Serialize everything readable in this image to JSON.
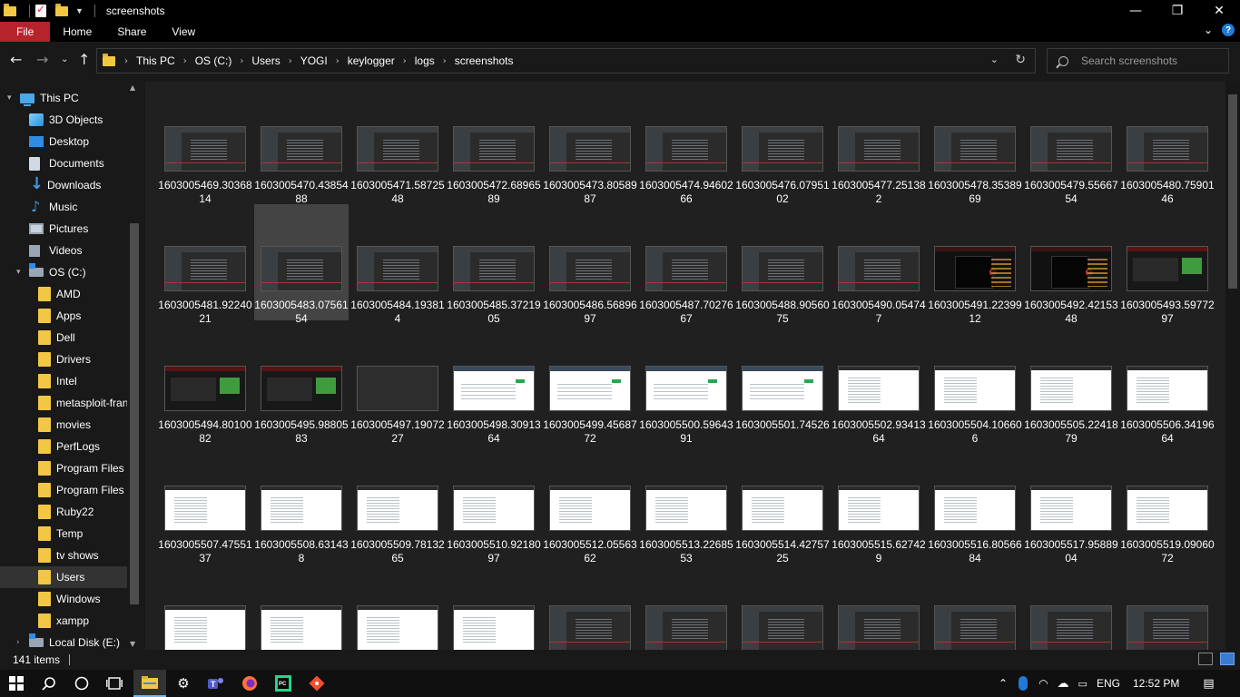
{
  "window": {
    "title": "screenshots",
    "controls": {
      "minimize": "—",
      "maximize": "❐",
      "close": "✕"
    }
  },
  "ribbon": {
    "tabs": [
      "File",
      "Home",
      "Share",
      "View"
    ],
    "file_color": "#b7232c"
  },
  "address": {
    "crumbs": [
      "This PC",
      "OS (C:)",
      "Users",
      "YOGI",
      "keylogger",
      "logs",
      "screenshots"
    ]
  },
  "search": {
    "placeholder": "Search screenshots"
  },
  "sidebar": {
    "items": [
      {
        "label": "This PC",
        "icon": "pc-icon"
      },
      {
        "label": "3D Objects",
        "icon": "3d-objects-icon"
      },
      {
        "label": "Desktop",
        "icon": "desktop-icon"
      },
      {
        "label": "Documents",
        "icon": "documents-icon"
      },
      {
        "label": "Downloads",
        "icon": "downloads-icon"
      },
      {
        "label": "Music",
        "icon": "music-icon"
      },
      {
        "label": "Pictures",
        "icon": "pictures-icon"
      },
      {
        "label": "Videos",
        "icon": "videos-icon"
      },
      {
        "label": "OS (C:)",
        "icon": "drive-icon"
      },
      {
        "label": "AMD",
        "icon": "folder-icon"
      },
      {
        "label": "Apps",
        "icon": "folder-icon"
      },
      {
        "label": "Dell",
        "icon": "folder-icon"
      },
      {
        "label": "Drivers",
        "icon": "folder-icon"
      },
      {
        "label": "Intel",
        "icon": "folder-icon"
      },
      {
        "label": "metasploit-fran",
        "icon": "folder-icon"
      },
      {
        "label": "movies",
        "icon": "folder-icon"
      },
      {
        "label": "PerfLogs",
        "icon": "folder-icon"
      },
      {
        "label": "Program Files",
        "icon": "folder-icon"
      },
      {
        "label": "Program Files (",
        "icon": "folder-icon"
      },
      {
        "label": "Ruby22",
        "icon": "folder-icon"
      },
      {
        "label": "Temp",
        "icon": "folder-icon"
      },
      {
        "label": "tv shows",
        "icon": "folder-icon"
      },
      {
        "label": "Users",
        "icon": "folder-icon",
        "selected": true
      },
      {
        "label": "Windows",
        "icon": "folder-icon"
      },
      {
        "label": "xampp",
        "icon": "folder-icon"
      },
      {
        "label": "Local Disk (E:)",
        "icon": "drive-icon"
      }
    ]
  },
  "files": [
    {
      "name": "1603005469.3036814",
      "thumb": "ide"
    },
    {
      "name": "1603005470.4385488",
      "thumb": "ide"
    },
    {
      "name": "1603005471.5872548",
      "thumb": "ide"
    },
    {
      "name": "1603005472.6896589",
      "thumb": "ide"
    },
    {
      "name": "1603005473.8058987",
      "thumb": "ide"
    },
    {
      "name": "1603005474.9460266",
      "thumb": "ide"
    },
    {
      "name": "1603005476.0795102",
      "thumb": "ide"
    },
    {
      "name": "1603005477.251382",
      "thumb": "ide"
    },
    {
      "name": "1603005478.3538969",
      "thumb": "ide"
    },
    {
      "name": "1603005479.5566754",
      "thumb": "ide"
    },
    {
      "name": "1603005480.7590146",
      "thumb": "ide"
    },
    {
      "name": "1603005481.9224021",
      "thumb": "ide"
    },
    {
      "name": "1603005483.0756154",
      "thumb": "ide",
      "selected": true
    },
    {
      "name": "1603005484.193814",
      "thumb": "ide"
    },
    {
      "name": "1603005485.3721905",
      "thumb": "ide"
    },
    {
      "name": "1603005486.5689697",
      "thumb": "ide"
    },
    {
      "name": "1603005487.7027667",
      "thumb": "ide"
    },
    {
      "name": "1603005488.9056075",
      "thumb": "ide"
    },
    {
      "name": "1603005490.054747",
      "thumb": "ide"
    },
    {
      "name": "1603005491.2239912",
      "thumb": "vid"
    },
    {
      "name": "1603005492.4215348",
      "thumb": "vid"
    },
    {
      "name": "1603005493.5977297",
      "thumb": "yt"
    },
    {
      "name": "1603005494.8010082",
      "thumb": "yt"
    },
    {
      "name": "1603005495.9880583",
      "thumb": "yt"
    },
    {
      "name": "1603005497.1907227",
      "thumb": "plain"
    },
    {
      "name": "1603005498.3091364",
      "thumb": "web"
    },
    {
      "name": "1603005499.4568772",
      "thumb": "web"
    },
    {
      "name": "1603005500.5964391",
      "thumb": "web"
    },
    {
      "name": "1603005501.74526",
      "thumb": "web"
    },
    {
      "name": "1603005502.9341364",
      "thumb": "code"
    },
    {
      "name": "1603005504.106606",
      "thumb": "code"
    },
    {
      "name": "1603005505.2241879",
      "thumb": "code"
    },
    {
      "name": "1603005506.3419664",
      "thumb": "code"
    },
    {
      "name": "1603005507.4755137",
      "thumb": "code"
    },
    {
      "name": "1603005508.631438",
      "thumb": "code"
    },
    {
      "name": "1603005509.7813265",
      "thumb": "code"
    },
    {
      "name": "1603005510.9218097",
      "thumb": "code"
    },
    {
      "name": "1603005512.0556362",
      "thumb": "code"
    },
    {
      "name": "1603005513.2268553",
      "thumb": "code"
    },
    {
      "name": "1603005514.4275725",
      "thumb": "code"
    },
    {
      "name": "1603005515.627429",
      "thumb": "code"
    },
    {
      "name": "1603005516.8056684",
      "thumb": "code"
    },
    {
      "name": "1603005517.9588904",
      "thumb": "code"
    },
    {
      "name": "1603005519.0906072",
      "thumb": "code"
    },
    {
      "name": "",
      "thumb": "code"
    },
    {
      "name": "",
      "thumb": "code"
    },
    {
      "name": "",
      "thumb": "code"
    },
    {
      "name": "",
      "thumb": "code"
    },
    {
      "name": "",
      "thumb": "ide"
    },
    {
      "name": "",
      "thumb": "ide"
    },
    {
      "name": "",
      "thumb": "ide"
    },
    {
      "name": "",
      "thumb": "ide"
    },
    {
      "name": "",
      "thumb": "ide"
    },
    {
      "name": "",
      "thumb": "ide"
    },
    {
      "name": "",
      "thumb": "ide"
    }
  ],
  "status": {
    "count": "141 items"
  },
  "taskbar": {
    "apps": [
      "start-icon",
      "search-icon",
      "cortana-icon",
      "task-view-icon",
      "file-explorer-icon",
      "settings-icon",
      "teams-icon",
      "firefox-icon",
      "pycharm-icon",
      "git-icon"
    ],
    "lang": "ENG",
    "time": "12:52 PM"
  }
}
